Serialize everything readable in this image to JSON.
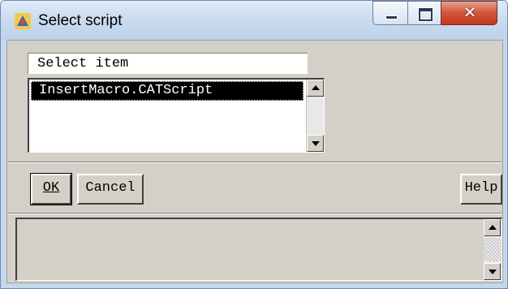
{
  "window": {
    "title": "Select script",
    "app_icon": "catia-app-icon",
    "controls": [
      "minimize-icon",
      "maximize-icon",
      "close-icon"
    ]
  },
  "select_label": "Select item",
  "list": {
    "items": [
      "InsertMacro.CATScript"
    ],
    "selected": "InsertMacro.CATScript"
  },
  "buttons": {
    "ok_label": "OK",
    "cancel_label": "Cancel",
    "help_label": "Help"
  },
  "colors": {
    "selection_bg": "#000000",
    "selection_fg": "#ffffff",
    "dialog_face": "#d4d0c8",
    "close_red": "#c13a1f"
  }
}
